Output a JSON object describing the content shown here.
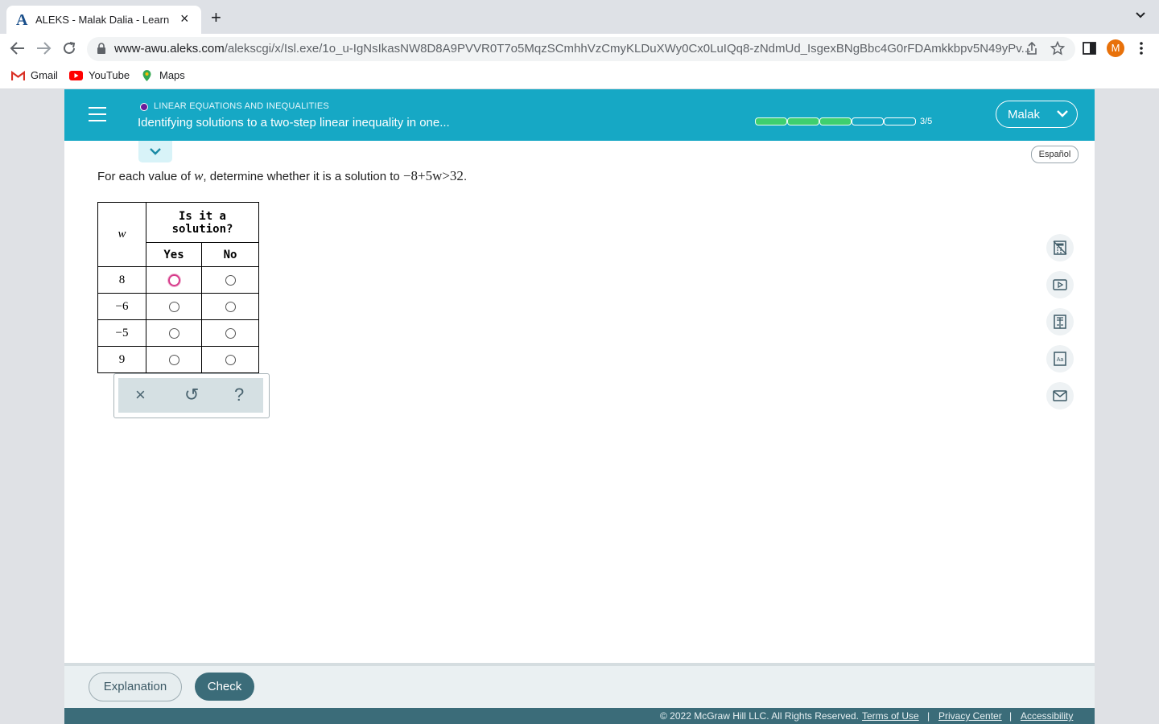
{
  "browser": {
    "tab_logo": "A",
    "tab_title": "ALEKS - Malak Dalia - Learn",
    "tab_close": "×",
    "new_tab": "+",
    "url_host": "www-awu.aleks.com",
    "url_path": "/alekscgi/x/Isl.exe/1o_u-IgNsIkasNW8D8A9PVVR0T7o5MqzSCmhhVzCmyKLDuXWy0Cx0LuIQq8-zNdmUd_IsgexBNgBbc4G0rFDAmkkbpv5N49yPv...",
    "profile_initial": "M",
    "bookmarks": [
      "Gmail",
      "YouTube",
      "Maps"
    ]
  },
  "header": {
    "topic_label": "LINEAR EQUATIONS AND INEQUALITIES",
    "topic_title": "Identifying solutions to a two-step linear inequality in one...",
    "progress": {
      "completed": 3,
      "total": 5,
      "text": "3/5"
    },
    "user_name": "Malak"
  },
  "language_button": "Español",
  "problem": {
    "prompt_prefix": "For each value of ",
    "variable": "w",
    "prompt_middle": ", determine whether it is a solution to ",
    "inequality": "−8+5w>32",
    "prompt_suffix": "."
  },
  "table": {
    "var_header": "w",
    "question_header": "Is it a solution?",
    "yes_label": "Yes",
    "no_label": "No",
    "rows": [
      {
        "value": "8"
      },
      {
        "value": "−6"
      },
      {
        "value": "−5"
      },
      {
        "value": "9"
      }
    ]
  },
  "keypad": {
    "clear": "×",
    "undo": "↺",
    "help": "?"
  },
  "side_tools": [
    "calculator-icon",
    "video-icon",
    "ebook-icon",
    "dictionary-icon",
    "message-icon"
  ],
  "footer": {
    "explanation_label": "Explanation",
    "check_label": "Check",
    "copyright": "© 2022 McGraw Hill LLC. All Rights Reserved.",
    "terms": "Terms of Use",
    "privacy": "Privacy Center",
    "accessibility": "Accessibility",
    "separator": "|"
  },
  "colors": {
    "header_bg": "#16a8c5",
    "progress_fill": "#3ecf6f",
    "check_bg": "#3b6c79",
    "focus_ring": "#d63a8a"
  }
}
